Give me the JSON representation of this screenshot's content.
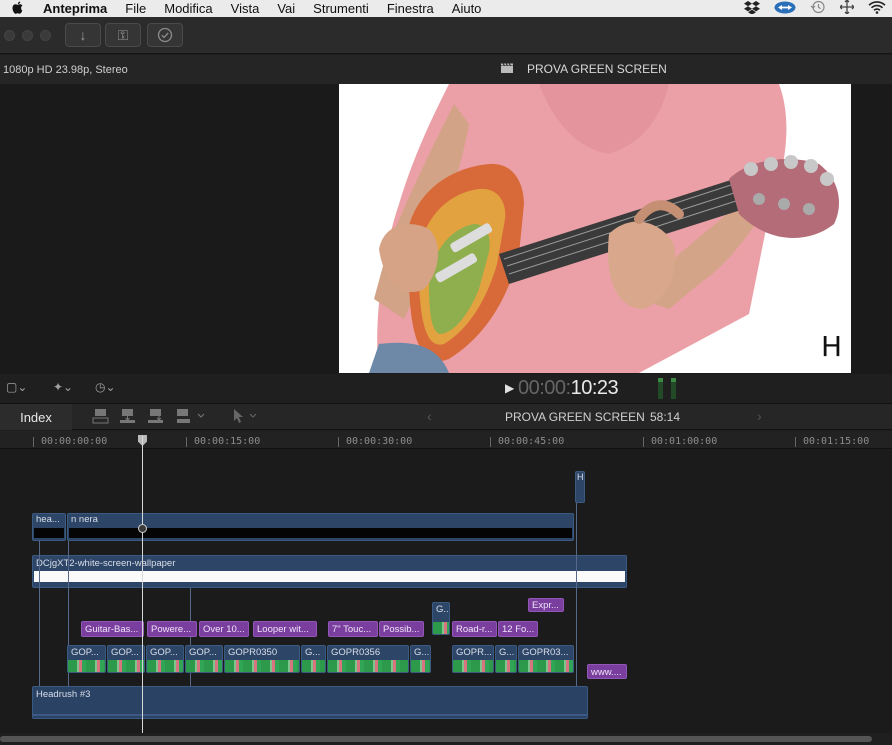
{
  "menubar": {
    "apple": "",
    "app": "Anteprima",
    "items": [
      "File",
      "Modifica",
      "Vista",
      "Vai",
      "Strumenti",
      "Finestra",
      "Aiuto"
    ],
    "status_icons": [
      "dropbox-icon",
      "teamviewer-icon",
      "time-machine-icon",
      "move-icon",
      "wifi-icon"
    ]
  },
  "toolbar": {
    "import_icon": "↓",
    "key_icon": "⚿",
    "check_icon": "✓"
  },
  "viewer": {
    "format": "1080p HD 23.98p, Stereo",
    "clapper_icon": "🎬",
    "project_title": "PROVA GREEN SCREEN",
    "overlay_glyph": "H"
  },
  "viewer_controls": {
    "view_icon": "▢⌄",
    "enhance_icon": "✦⌄",
    "speed_icon": "◷⌄",
    "play_icon": "▶",
    "timecode_dim": "00:00:",
    "timecode_bright": "10:23"
  },
  "timeline_header": {
    "index": "Index",
    "prev": "‹",
    "next": "›",
    "project_name": "PROVA GREEN SCREEN",
    "duration": "58:14"
  },
  "ruler": {
    "marks": [
      "00:00:00:00",
      "00:00:15:00",
      "00:00:30:00",
      "00:00:45:00",
      "00:01:00:00",
      "00:01:15:00"
    ]
  },
  "clips": {
    "hea": "hea...",
    "nnera": "n nera",
    "wallpaper": "DCjgXT2-white-screen-wallpaper",
    "titles": [
      "Guitar-Bas...",
      "Powere...",
      "Over 10...",
      "Looper wit...",
      "7\" Touc...",
      "Possib...",
      "Road-r...",
      "12 Fo...",
      "Expr...",
      "www...."
    ],
    "gopro": [
      "GOP...",
      "GOP...",
      "GOP...",
      "GOP...",
      "GOPR0350",
      "G...",
      "GOPR0356",
      "G...",
      "GOPR...",
      "G...",
      "GOPR03..."
    ],
    "small_g": "G...",
    "headrush": "Headrush #3",
    "marker": "H"
  },
  "colors": {
    "video_clip": "#2d4566",
    "title_clip": "#7a3f9e",
    "background": "#1e1e1e"
  }
}
